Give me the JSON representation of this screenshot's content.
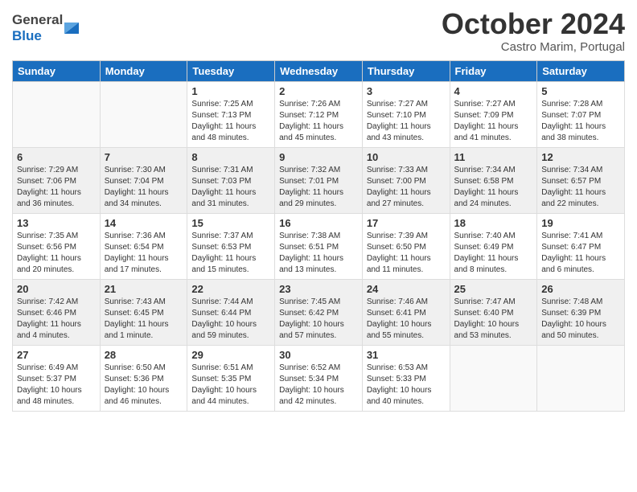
{
  "header": {
    "logo_general": "General",
    "logo_blue": "Blue",
    "month_title": "October 2024",
    "subtitle": "Castro Marim, Portugal"
  },
  "days_of_week": [
    "Sunday",
    "Monday",
    "Tuesday",
    "Wednesday",
    "Thursday",
    "Friday",
    "Saturday"
  ],
  "weeks": [
    {
      "shaded": false,
      "days": [
        {
          "num": "",
          "detail": ""
        },
        {
          "num": "",
          "detail": ""
        },
        {
          "num": "1",
          "detail": "Sunrise: 7:25 AM\nSunset: 7:13 PM\nDaylight: 11 hours and 48 minutes."
        },
        {
          "num": "2",
          "detail": "Sunrise: 7:26 AM\nSunset: 7:12 PM\nDaylight: 11 hours and 45 minutes."
        },
        {
          "num": "3",
          "detail": "Sunrise: 7:27 AM\nSunset: 7:10 PM\nDaylight: 11 hours and 43 minutes."
        },
        {
          "num": "4",
          "detail": "Sunrise: 7:27 AM\nSunset: 7:09 PM\nDaylight: 11 hours and 41 minutes."
        },
        {
          "num": "5",
          "detail": "Sunrise: 7:28 AM\nSunset: 7:07 PM\nDaylight: 11 hours and 38 minutes."
        }
      ]
    },
    {
      "shaded": true,
      "days": [
        {
          "num": "6",
          "detail": "Sunrise: 7:29 AM\nSunset: 7:06 PM\nDaylight: 11 hours and 36 minutes."
        },
        {
          "num": "7",
          "detail": "Sunrise: 7:30 AM\nSunset: 7:04 PM\nDaylight: 11 hours and 34 minutes."
        },
        {
          "num": "8",
          "detail": "Sunrise: 7:31 AM\nSunset: 7:03 PM\nDaylight: 11 hours and 31 minutes."
        },
        {
          "num": "9",
          "detail": "Sunrise: 7:32 AM\nSunset: 7:01 PM\nDaylight: 11 hours and 29 minutes."
        },
        {
          "num": "10",
          "detail": "Sunrise: 7:33 AM\nSunset: 7:00 PM\nDaylight: 11 hours and 27 minutes."
        },
        {
          "num": "11",
          "detail": "Sunrise: 7:34 AM\nSunset: 6:58 PM\nDaylight: 11 hours and 24 minutes."
        },
        {
          "num": "12",
          "detail": "Sunrise: 7:34 AM\nSunset: 6:57 PM\nDaylight: 11 hours and 22 minutes."
        }
      ]
    },
    {
      "shaded": false,
      "days": [
        {
          "num": "13",
          "detail": "Sunrise: 7:35 AM\nSunset: 6:56 PM\nDaylight: 11 hours and 20 minutes."
        },
        {
          "num": "14",
          "detail": "Sunrise: 7:36 AM\nSunset: 6:54 PM\nDaylight: 11 hours and 17 minutes."
        },
        {
          "num": "15",
          "detail": "Sunrise: 7:37 AM\nSunset: 6:53 PM\nDaylight: 11 hours and 15 minutes."
        },
        {
          "num": "16",
          "detail": "Sunrise: 7:38 AM\nSunset: 6:51 PM\nDaylight: 11 hours and 13 minutes."
        },
        {
          "num": "17",
          "detail": "Sunrise: 7:39 AM\nSunset: 6:50 PM\nDaylight: 11 hours and 11 minutes."
        },
        {
          "num": "18",
          "detail": "Sunrise: 7:40 AM\nSunset: 6:49 PM\nDaylight: 11 hours and 8 minutes."
        },
        {
          "num": "19",
          "detail": "Sunrise: 7:41 AM\nSunset: 6:47 PM\nDaylight: 11 hours and 6 minutes."
        }
      ]
    },
    {
      "shaded": true,
      "days": [
        {
          "num": "20",
          "detail": "Sunrise: 7:42 AM\nSunset: 6:46 PM\nDaylight: 11 hours and 4 minutes."
        },
        {
          "num": "21",
          "detail": "Sunrise: 7:43 AM\nSunset: 6:45 PM\nDaylight: 11 hours and 1 minute."
        },
        {
          "num": "22",
          "detail": "Sunrise: 7:44 AM\nSunset: 6:44 PM\nDaylight: 10 hours and 59 minutes."
        },
        {
          "num": "23",
          "detail": "Sunrise: 7:45 AM\nSunset: 6:42 PM\nDaylight: 10 hours and 57 minutes."
        },
        {
          "num": "24",
          "detail": "Sunrise: 7:46 AM\nSunset: 6:41 PM\nDaylight: 10 hours and 55 minutes."
        },
        {
          "num": "25",
          "detail": "Sunrise: 7:47 AM\nSunset: 6:40 PM\nDaylight: 10 hours and 53 minutes."
        },
        {
          "num": "26",
          "detail": "Sunrise: 7:48 AM\nSunset: 6:39 PM\nDaylight: 10 hours and 50 minutes."
        }
      ]
    },
    {
      "shaded": false,
      "days": [
        {
          "num": "27",
          "detail": "Sunrise: 6:49 AM\nSunset: 5:37 PM\nDaylight: 10 hours and 48 minutes."
        },
        {
          "num": "28",
          "detail": "Sunrise: 6:50 AM\nSunset: 5:36 PM\nDaylight: 10 hours and 46 minutes."
        },
        {
          "num": "29",
          "detail": "Sunrise: 6:51 AM\nSunset: 5:35 PM\nDaylight: 10 hours and 44 minutes."
        },
        {
          "num": "30",
          "detail": "Sunrise: 6:52 AM\nSunset: 5:34 PM\nDaylight: 10 hours and 42 minutes."
        },
        {
          "num": "31",
          "detail": "Sunrise: 6:53 AM\nSunset: 5:33 PM\nDaylight: 10 hours and 40 minutes."
        },
        {
          "num": "",
          "detail": ""
        },
        {
          "num": "",
          "detail": ""
        }
      ]
    }
  ]
}
